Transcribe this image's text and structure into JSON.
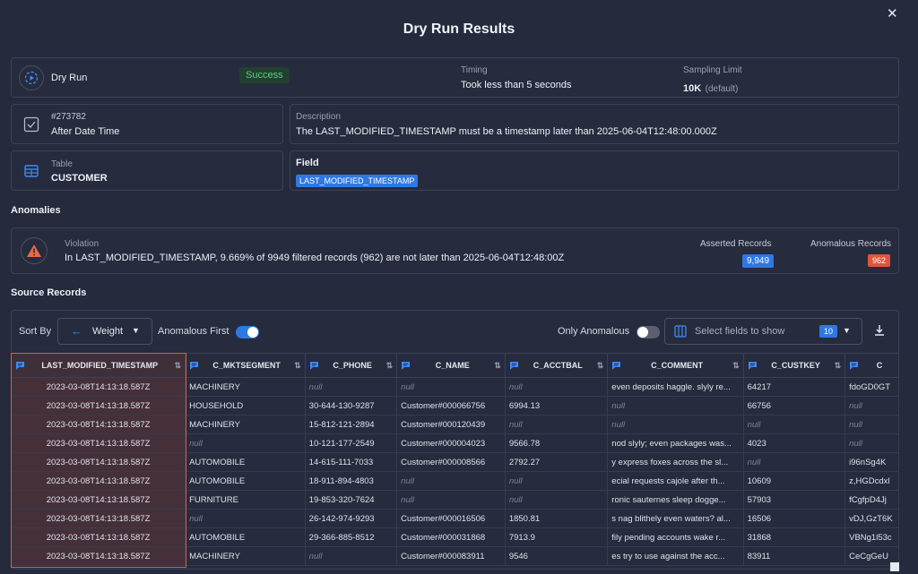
{
  "title": "Dry Run Results",
  "dry_run": {
    "label": "Dry Run",
    "status": "Success",
    "timing_label": "Timing",
    "timing_value": "Took less than 5 seconds",
    "sampling_label": "Sampling Limit",
    "sampling_value": "10K",
    "sampling_note": "(default)"
  },
  "check": {
    "id": "#273782",
    "name": "After Date Time",
    "description_label": "Description",
    "description": "The LAST_MODIFIED_TIMESTAMP must be a timestamp later than 2025-06-04T12:48:00.000Z"
  },
  "table_info": {
    "table_label": "Table",
    "table_name": "CUSTOMER",
    "field_label": "Field",
    "field_name": "LAST_MODIFIED_TIMESTAMP"
  },
  "anomalies": {
    "heading": "Anomalies",
    "violation_label": "Violation",
    "violation_text": "In LAST_MODIFIED_TIMESTAMP, 9.669% of 9949 filtered records (962) are not later than 2025-06-04T12:48:00Z",
    "asserted_label": "Asserted Records",
    "asserted_value": "9,949",
    "anomalous_label": "Anomalous Records",
    "anomalous_value": "962"
  },
  "source": {
    "heading": "Source Records",
    "sort_by_label": "Sort By",
    "sort_value": "Weight",
    "anomalous_first_label": "Anomalous First",
    "anomalous_first_on": true,
    "only_anomalous_label": "Only Anomalous",
    "only_anomalous_on": false,
    "fields_placeholder": "Select fields to show",
    "fields_count": "10"
  },
  "colors": {
    "background": "#252a3c",
    "accent": "#2f78e3",
    "success": "#5ecb82",
    "danger": "#e0553b"
  },
  "grid": {
    "columns": [
      "LAST_MODIFIED_TIMESTAMP",
      "C_MKTSEGMENT",
      "C_PHONE",
      "C_NAME",
      "C_ACCTBAL",
      "C_COMMENT",
      "C_CUSTKEY",
      "C"
    ],
    "rows": [
      [
        "2023-03-08T14:13:18.587Z",
        "MACHINERY",
        "null",
        "null",
        "null",
        "even deposits haggle. slyly re...",
        "64217",
        "fdoGD0GT"
      ],
      [
        "2023-03-08T14:13:18.587Z",
        "HOUSEHOLD",
        "30-644-130-9287",
        "Customer#000066756",
        "6994.13",
        "null",
        "66756",
        "null"
      ],
      [
        "2023-03-08T14:13:18.587Z",
        "MACHINERY",
        "15-812-121-2894",
        "Customer#000120439",
        "null",
        "null",
        "null",
        "null"
      ],
      [
        "2023-03-08T14:13:18.587Z",
        "null",
        "10-121-177-2549",
        "Customer#000004023",
        "9566.78",
        "nod slyly; even packages was...",
        "4023",
        "null"
      ],
      [
        "2023-03-08T14:13:18.587Z",
        "AUTOMOBILE",
        "14-615-111-7033",
        "Customer#000008566",
        "2792.27",
        "y express foxes across the sl...",
        "null",
        "i96nSg4K"
      ],
      [
        "2023-03-08T14:13:18.587Z",
        "AUTOMOBILE",
        "18-911-894-4803",
        "null",
        "null",
        "ecial requests cajole after th...",
        "10609",
        "z,HGDcdxl"
      ],
      [
        "2023-03-08T14:13:18.587Z",
        "FURNITURE",
        "19-853-320-7624",
        "null",
        "null",
        "ronic sauternes sleep dogge...",
        "57903",
        "fCgfpD4Jj"
      ],
      [
        "2023-03-08T14:13:18.587Z",
        "null",
        "26-142-974-9293",
        "Customer#000016506",
        "1850.81",
        "s nag blithely even waters? al...",
        "16506",
        "vDJ,GzT6K"
      ],
      [
        "2023-03-08T14:13:18.587Z",
        "AUTOMOBILE",
        "29-366-885-8512",
        "Customer#000031868",
        "7913.9",
        "fily pending accounts wake r...",
        "31868",
        "VBNg1l53c"
      ],
      [
        "2023-03-08T14:13:18.587Z",
        "MACHINERY",
        "null",
        "Customer#000083911",
        "9546",
        "es try to use against the acc...",
        "83911",
        "CeCgGeU"
      ]
    ]
  }
}
